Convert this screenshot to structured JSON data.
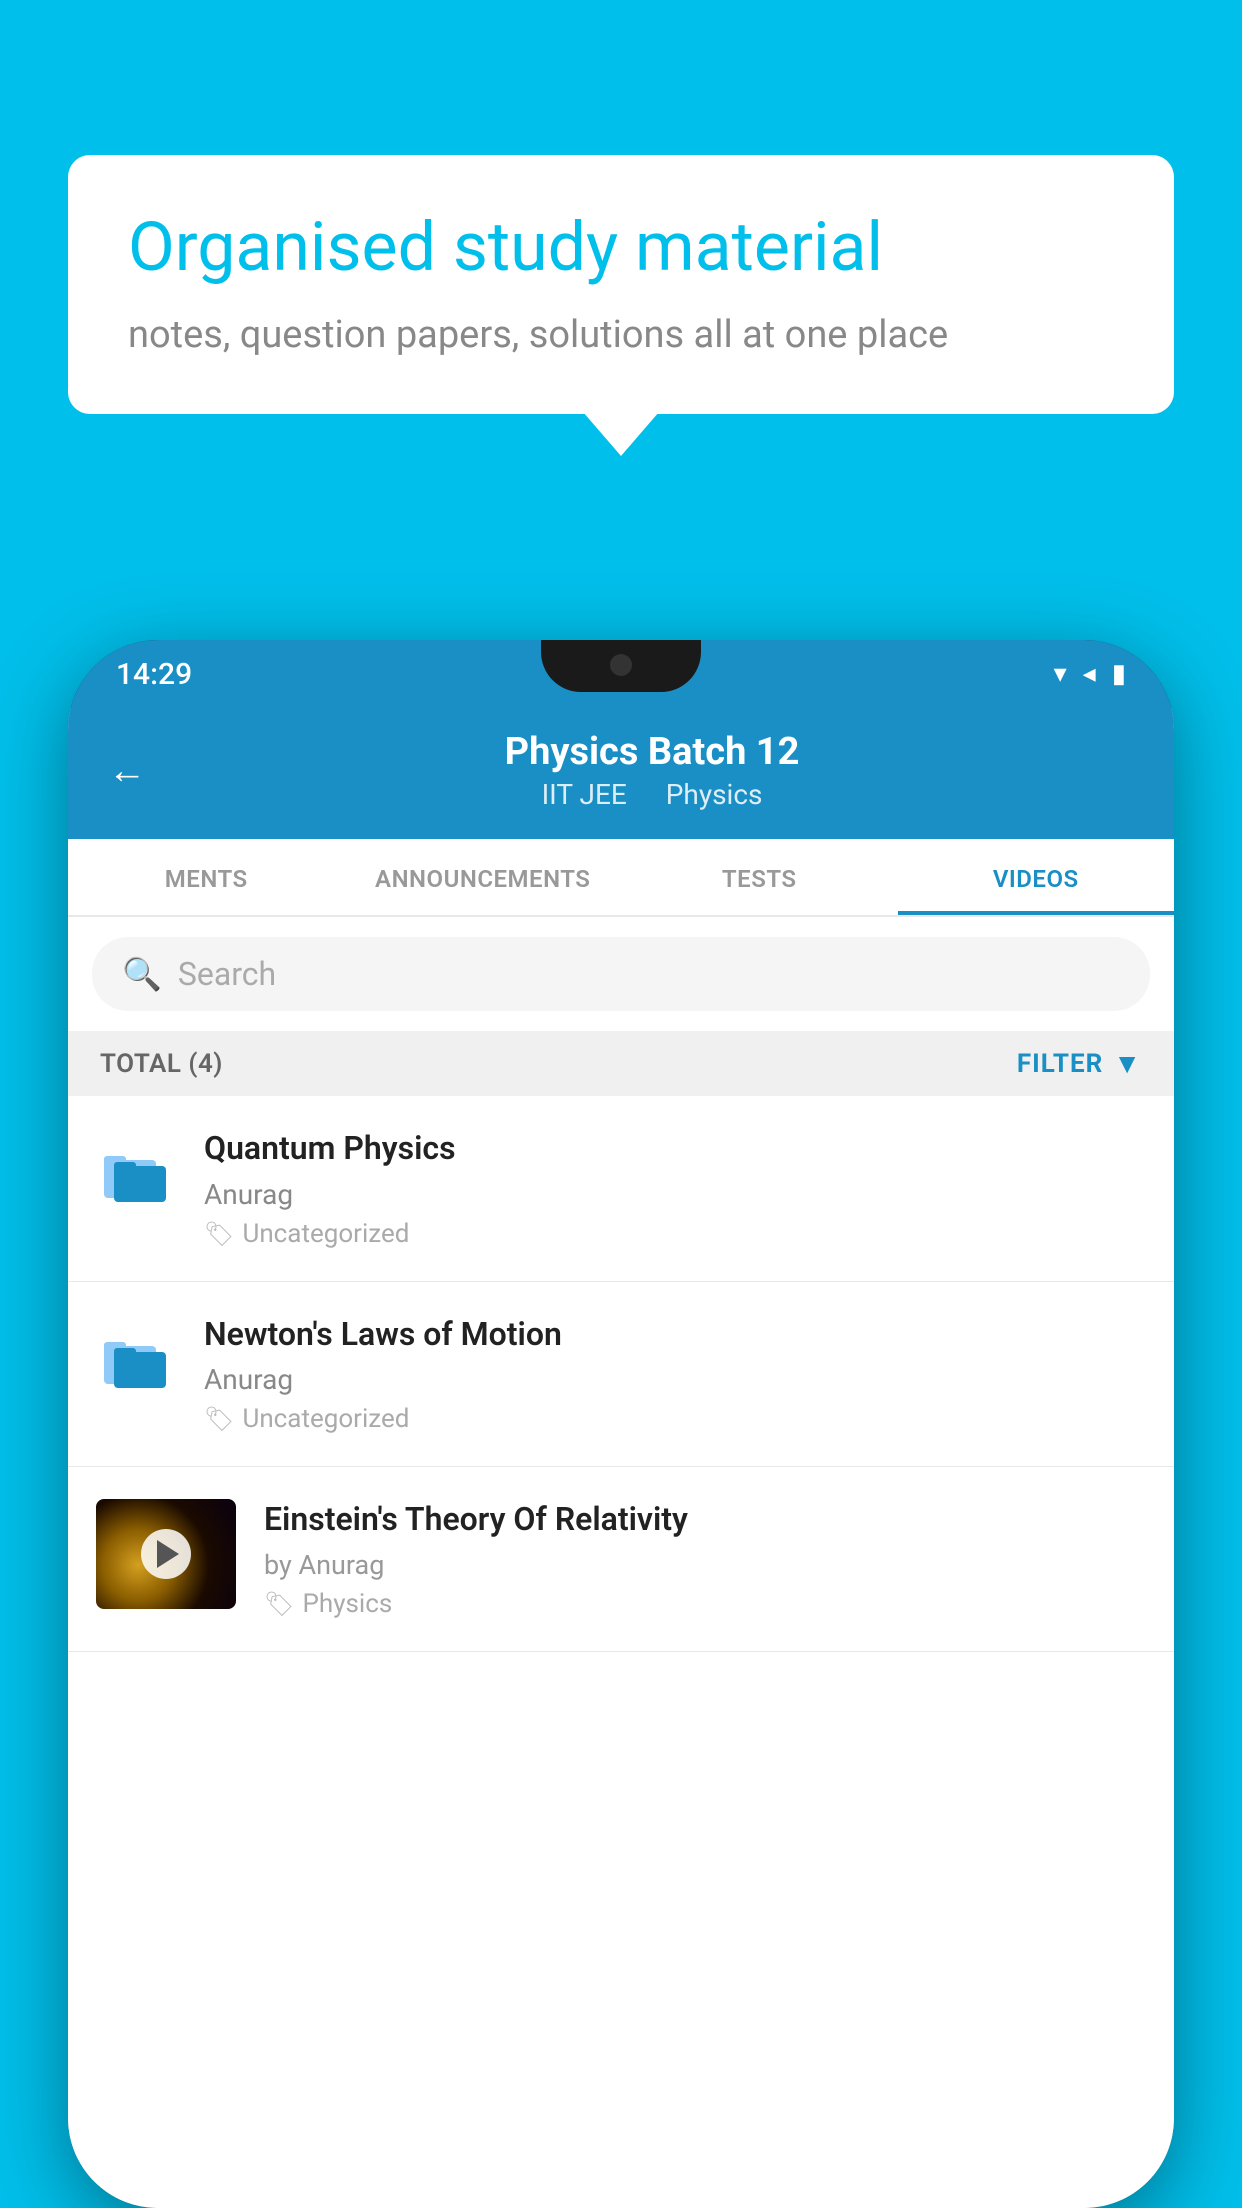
{
  "background_color": "#00BFEA",
  "speech_bubble": {
    "heading": "Organised study material",
    "subtext": "notes, question papers, solutions all at one place"
  },
  "status_bar": {
    "time": "14:29",
    "icons": [
      "wifi",
      "signal",
      "battery"
    ]
  },
  "app_header": {
    "back_label": "←",
    "title": "Physics Batch 12",
    "subtitle_tag1": "IIT JEE",
    "subtitle_tag2": "Physics"
  },
  "tabs": [
    {
      "label": "MENTS",
      "active": false
    },
    {
      "label": "ANNOUNCEMENTS",
      "active": false
    },
    {
      "label": "TESTS",
      "active": false
    },
    {
      "label": "VIDEOS",
      "active": true
    }
  ],
  "search": {
    "placeholder": "Search"
  },
  "filter_bar": {
    "total_label": "TOTAL (4)",
    "filter_label": "FILTER"
  },
  "video_items": [
    {
      "id": 1,
      "title": "Quantum Physics",
      "author": "Anurag",
      "tag": "Uncategorized",
      "has_thumbnail": false
    },
    {
      "id": 2,
      "title": "Newton's Laws of Motion",
      "author": "Anurag",
      "tag": "Uncategorized",
      "has_thumbnail": false
    },
    {
      "id": 3,
      "title": "Einstein's Theory Of Relativity",
      "author": "by Anurag",
      "tag": "Physics",
      "has_thumbnail": true
    }
  ]
}
